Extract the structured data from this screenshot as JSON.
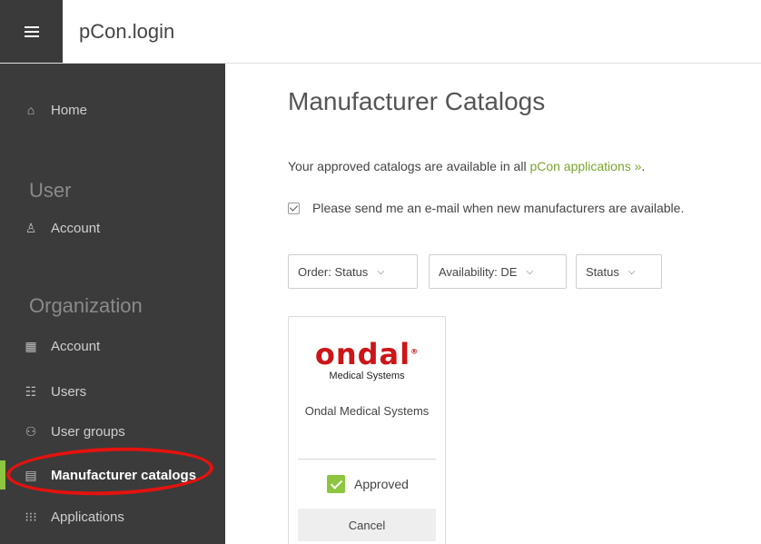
{
  "app": {
    "title": "pCon.login"
  },
  "sidebar": {
    "home": {
      "label": "Home",
      "icon": "home-icon"
    },
    "sections": [
      {
        "title": "User",
        "items": [
          {
            "label": "Account",
            "icon": "user-icon"
          }
        ]
      },
      {
        "title": "Organization",
        "items": [
          {
            "label": "Account",
            "icon": "building-icon"
          },
          {
            "label": "Users",
            "icon": "users-icon"
          },
          {
            "label": "User groups",
            "icon": "user-groups-icon"
          },
          {
            "label": "Manufacturer catalogs",
            "icon": "catalog-icon",
            "active": true
          },
          {
            "label": "Applications",
            "icon": "applications-grid-icon"
          }
        ]
      }
    ],
    "accent_color": "#8cc63f",
    "highlight_color": "#e3130f"
  },
  "main": {
    "title": "Manufacturer Catalogs",
    "intro_text": "Your approved catalogs are available in all ",
    "intro_link": "pCon applications »",
    "intro_end": ".",
    "notify_label": "Please send me an e-mail when new manufacturers are available.",
    "notify_checked": true,
    "filters": [
      {
        "label": "Order: Status"
      },
      {
        "label": "Availability: DE"
      },
      {
        "label": "Status"
      }
    ],
    "catalogs": [
      {
        "logo_text": "ondal",
        "logo_mark": "®",
        "logo_sub": "Medical Systems",
        "name": "Ondal Medical Systems",
        "status_label": "Approved",
        "approved": true,
        "cancel_label": "Cancel"
      }
    ]
  }
}
